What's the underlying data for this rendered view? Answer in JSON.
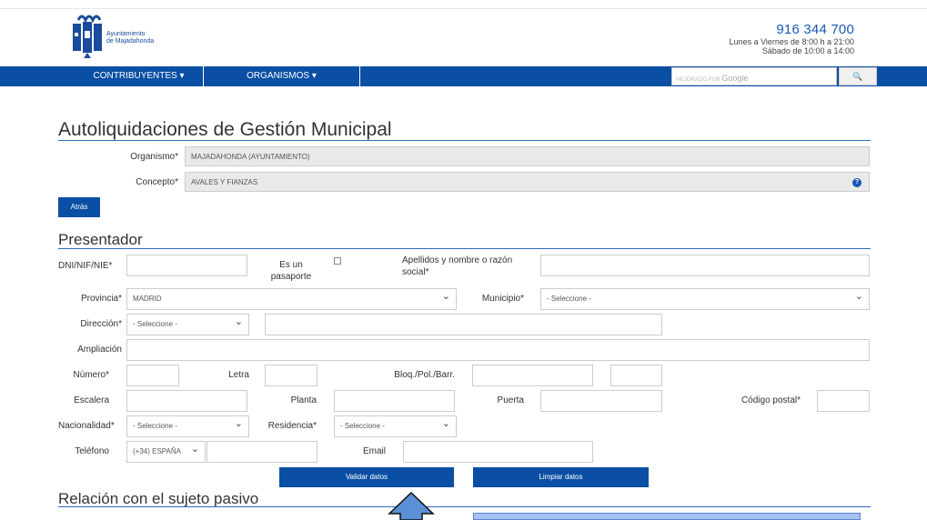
{
  "header": {
    "logo_line1": "Ayuntamiento",
    "logo_line2": "de Majadahonda",
    "phone": "916 344 700",
    "hours1": "Lunes a Viernes de 8:00 h a 21:00",
    "hours2": "Sábado de 10:00 a 14:00"
  },
  "nav": {
    "items": [
      {
        "label": "CONTRIBUYENTES ▾"
      },
      {
        "label": "ORGANISMOS ▾"
      }
    ],
    "search_prefix": "MEJORADO POR",
    "search_brand": "Google",
    "search_button_icon": "🔍"
  },
  "page": {
    "title": "Autoliquidaciones de Gestión Municipal",
    "organismo_label": "Organismo*",
    "organismo_value": "MAJADAHONDA (AYUNTAMIENTO)",
    "concepto_label": "Concepto*",
    "concepto_value": "AVALES Y FIANZAS",
    "help_icon": "?",
    "back_label": "Atrás"
  },
  "presentador": {
    "title": "Presentador",
    "dni_label": "DNI/NIF/NIE*",
    "pasaporte_label1": "Es un",
    "pasaporte_label2": "pasaporte",
    "apellidos_label1": "Apellidos y nombre o razón",
    "apellidos_label2": "social*",
    "provincia_label": "Provincia*",
    "provincia_value": "MADRID",
    "municipio_label": "Municipio*",
    "municipio_value": "- Seleccione -",
    "direccion_label": "Dirección*",
    "direccion_value": "- Seleccione -",
    "ampliacion_label": "Ampliación",
    "numero_label": "Número*",
    "letra_label": "Letra",
    "bloq_label": "Bloq./Pol./Barr.",
    "escalera_label": "Escalera",
    "planta_label": "Planta",
    "puerta_label": "Puerta",
    "cp_label": "Código postal*",
    "nacionalidad_label": "Nacionalidad*",
    "nacionalidad_value": "- Seleccione -",
    "residencia_label": "Residencia*",
    "residencia_value": "- Seleccione -",
    "telefono_label": "Teléfono",
    "telefono_prefix": "(+34) ESPAÑA",
    "email_label": "Email",
    "validar_label": "Validar datos",
    "limpiar_label": "Limpiar datos"
  },
  "relacion": {
    "title": "Relación con el sujeto pasivo"
  },
  "colors": {
    "nav_blue": "#0a4fa3",
    "rule_blue": "#2b6cbf",
    "arrow_fill": "#5b8fd6"
  }
}
